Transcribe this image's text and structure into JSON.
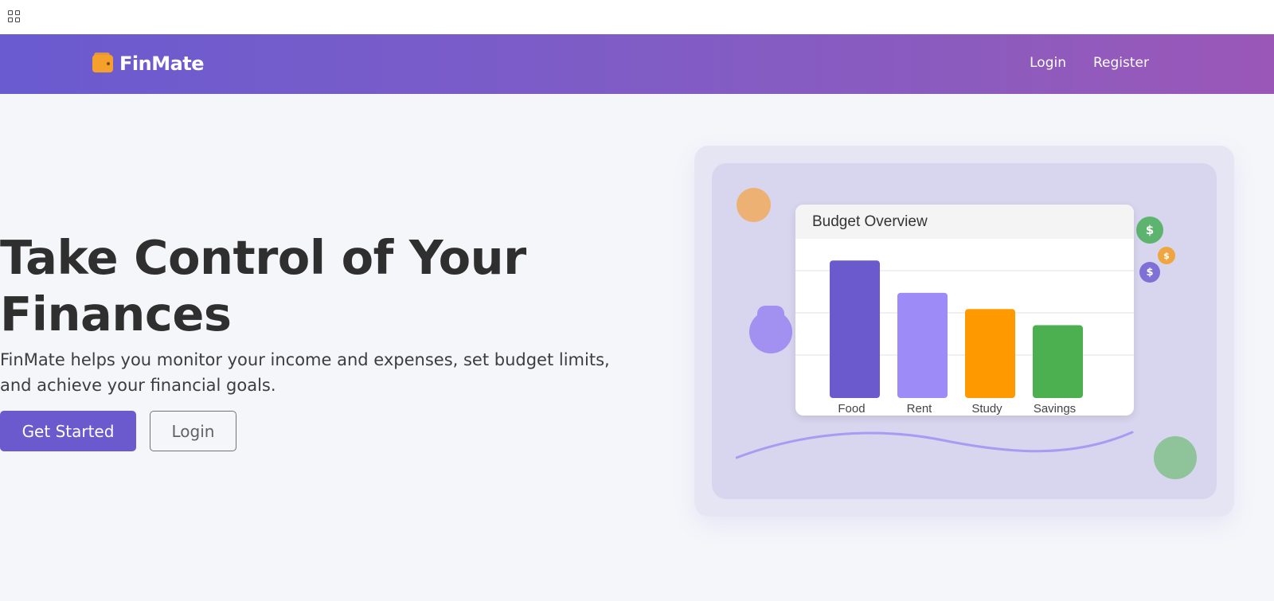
{
  "browser": {
    "apps_icon": "apps-grid-icon"
  },
  "navbar": {
    "brand_icon": "wallet-icon",
    "brand_name": "FinMate",
    "links": [
      "Login",
      "Register"
    ]
  },
  "hero": {
    "title": "Take Control of Your Finances",
    "description": "FinMate helps you monitor your income and expenses, set budget limits, and achieve your financial goals.",
    "primary_button": "Get Started",
    "secondary_button": "Login"
  },
  "illustration": {
    "coin_symbol": "$",
    "chart_title": "Budget Overview"
  },
  "chart_data": {
    "type": "bar",
    "title": "Budget Overview",
    "categories": [
      "Food",
      "Rent",
      "Study",
      "Savings"
    ],
    "values": [
      85,
      65,
      55,
      45
    ],
    "ylim": [
      0,
      100
    ],
    "grid": true,
    "colors": [
      "#6a5acd",
      "#9d8bf7",
      "#ff9900",
      "#4caf50"
    ]
  },
  "colors": {
    "primary": "#6a5acd",
    "accent_orange": "#f5a02b",
    "nav_gradient_start": "#6a5bd0",
    "nav_gradient_end": "#9a57b8"
  }
}
